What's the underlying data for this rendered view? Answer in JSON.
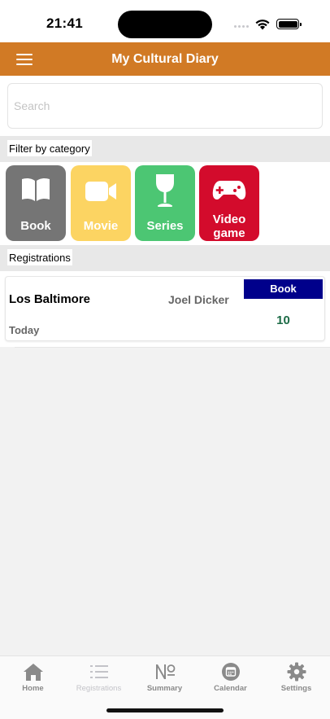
{
  "status_bar": {
    "time": "21:41"
  },
  "header": {
    "title": "My Cultural Diary",
    "menu_icon": "hamburger-menu-icon"
  },
  "search": {
    "placeholder": "Search",
    "value": ""
  },
  "filter": {
    "label": "Filter by category",
    "categories": [
      {
        "line1": "Book",
        "line2": "",
        "icon": "open-book-icon",
        "color": "#757575"
      },
      {
        "line1": "Movie",
        "line2": "",
        "icon": "video-camera-icon",
        "color": "#fcd462"
      },
      {
        "line1": "Series",
        "line2": "",
        "icon": "wine-glass-icon",
        "color": "#4cc673"
      },
      {
        "line1": "Video",
        "line2": "game",
        "icon": "gamepad-icon",
        "color": "#d30b2c"
      }
    ]
  },
  "registrations": {
    "label": "Registrations",
    "items": [
      {
        "title": "Los Baltimore",
        "author": "Joel Dicker",
        "category": "Book",
        "score": "10",
        "date": "Today",
        "badge_color": "#00008b"
      }
    ]
  },
  "tabs": [
    {
      "label": "Home",
      "icon": "home-icon",
      "active": false
    },
    {
      "label": "Registrations",
      "icon": "list-icon",
      "active": true
    },
    {
      "label": "Summary",
      "icon": "numero-icon",
      "active": false
    },
    {
      "label": "Calendar",
      "icon": "calendar-icon",
      "active": false
    },
    {
      "label": "Settings",
      "icon": "gear-icon",
      "active": false
    }
  ]
}
